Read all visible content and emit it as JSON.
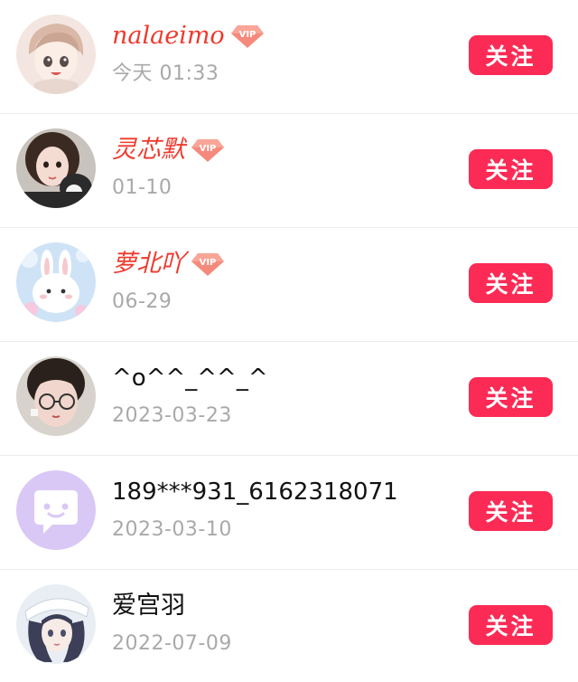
{
  "follow_label": "关注",
  "accent_color": "#fb2b55",
  "vip_name_color": "#ee3a2e",
  "vip_badge_text": "VIP",
  "users": [
    {
      "name": "nalaeimo",
      "vip": true,
      "time": "今天 01:33",
      "avatar": "anime-boy-avatar"
    },
    {
      "name": "灵芯默",
      "vip": true,
      "time": "01-10",
      "avatar": "girl-with-cat-avatar"
    },
    {
      "name": "萝北吖",
      "vip": true,
      "time": "06-29",
      "avatar": "bunny-avatar"
    },
    {
      "name": "^o^^_^^_^",
      "vip": false,
      "time": "2023-03-23",
      "avatar": "girl-with-glasses-avatar"
    },
    {
      "name": "189***931_6162318071",
      "vip": false,
      "time": "2023-03-10",
      "avatar": "default-chat-avatar"
    },
    {
      "name": "爱宫羽",
      "vip": false,
      "time": "2022-07-09",
      "avatar": "anime-girl-avatar"
    }
  ]
}
